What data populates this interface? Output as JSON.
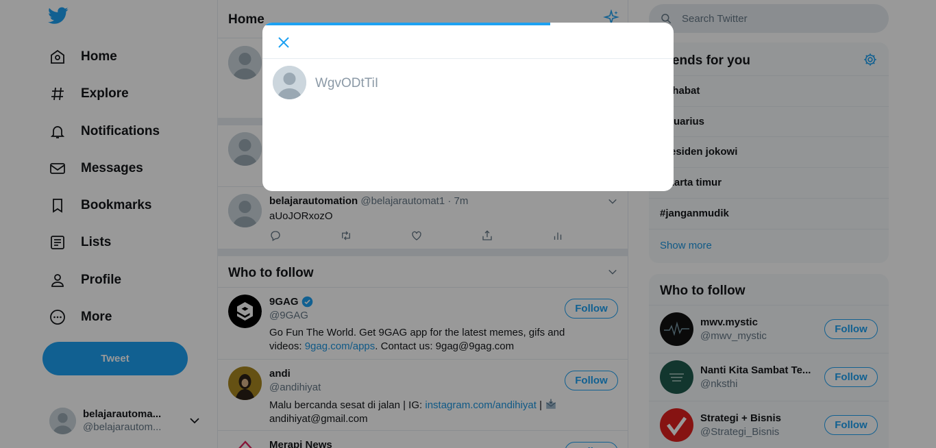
{
  "nav": {
    "items": [
      {
        "label": "Home",
        "icon": "home-icon"
      },
      {
        "label": "Explore",
        "icon": "hashtag-icon"
      },
      {
        "label": "Notifications",
        "icon": "bell-icon"
      },
      {
        "label": "Messages",
        "icon": "envelope-icon"
      },
      {
        "label": "Bookmarks",
        "icon": "bookmark-icon"
      },
      {
        "label": "Lists",
        "icon": "list-icon"
      },
      {
        "label": "Profile",
        "icon": "person-icon"
      },
      {
        "label": "More",
        "icon": "more-circle-icon"
      }
    ],
    "tweet_button": "Tweet",
    "account": {
      "name": "belajarautoma...",
      "handle": "@belajarautom..."
    }
  },
  "feed": {
    "title": "Home",
    "tweet": {
      "name": "belajarautomation",
      "handle": "@belajarautomat1",
      "time": "· 7m",
      "text": "aUoJORxozO"
    },
    "who_to_follow": {
      "title": "Who to follow",
      "follow_label": "Follow",
      "users": [
        {
          "name": "9GAG",
          "handle": "@9GAG",
          "bio_text": "Go Fun The World. Get 9GAG app for the latest memes, gifs and videos:",
          "bio_link": "9gag.com/apps",
          "bio_tail": ". Contact us: 9gag@9gag.com"
        },
        {
          "name": "andi",
          "handle": "@andihiyat",
          "bio_text": "Malu bercanda sesat di jalan | IG:",
          "bio_link": "instagram.com/andihiyat",
          "bio_tail": "|",
          "bio_line2": "andihiyat@gmail.com"
        },
        {
          "name": "Merapi News"
        }
      ]
    }
  },
  "right": {
    "search_placeholder": "Search Twitter",
    "trends": {
      "title": "Trends for you",
      "items": [
        "Sahabat",
        "Aquarius",
        "presiden jokowi",
        "jakarta timur",
        "#janganmudik"
      ],
      "show_more": "Show more"
    },
    "who_to_follow": {
      "title": "Who to follow",
      "follow_label": "Follow",
      "users": [
        {
          "name": "mwv.mystic",
          "handle": "@mwv_mystic"
        },
        {
          "name": "Nanti Kita Sambat Te...",
          "handle": "@nksthi"
        },
        {
          "name": "Strategi + Bisnis",
          "handle": "@Strategi_Bisnis"
        }
      ]
    }
  },
  "modal": {
    "compose_text": "WgvODtTiI"
  },
  "colors": {
    "accent": "#1da1f2",
    "link": "#1b95e0",
    "overlay": "rgba(0,0,0,0.4)"
  }
}
